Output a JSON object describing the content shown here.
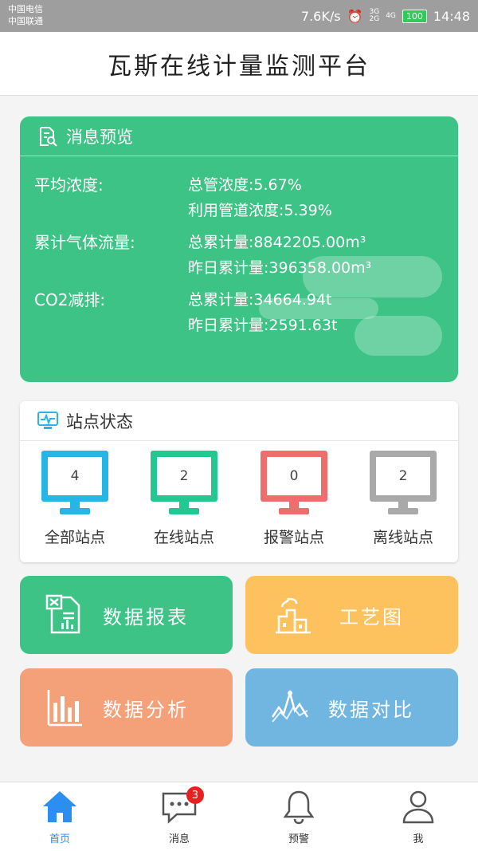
{
  "status_bar": {
    "carrier_1": "中国电信",
    "carrier_2": "中国联通",
    "speed": "7.6K/s",
    "signal_1": "3G",
    "signal_2": "2G",
    "signal_3": "4G",
    "battery": "100",
    "time": "14:48"
  },
  "header": {
    "title": "瓦斯在线计量监测平台"
  },
  "overview": {
    "title": "消息预览",
    "rows": [
      {
        "label": "平均浓度:",
        "lines": [
          "总管浓度:5.67%",
          "利用管道浓度:5.39%"
        ]
      },
      {
        "label": "累计气体流量:",
        "lines": [
          "总累计量:8842205.00m³",
          "昨日累计量:396358.00m³"
        ]
      },
      {
        "label": "CO2减排:",
        "lines": [
          "总累计量:34664.94t",
          "昨日累计量:2591.63t"
        ]
      }
    ]
  },
  "station_status": {
    "title": "站点状态",
    "items": [
      {
        "label": "全部站点",
        "count": "4",
        "color": "#27b5e6"
      },
      {
        "label": "在线站点",
        "count": "2",
        "color": "#22c88f"
      },
      {
        "label": "报警站点",
        "count": "0",
        "color": "#ec6f6d"
      },
      {
        "label": "离线站点",
        "count": "2",
        "color": "#a9a9a9"
      }
    ]
  },
  "tiles": [
    {
      "label": "数据报表",
      "icon": "report-sheet-icon",
      "color": "#3ec386"
    },
    {
      "label": "工艺图",
      "icon": "factory-icon",
      "color": "#fdc25d"
    },
    {
      "label": "数据分析",
      "icon": "bar-chart-icon",
      "color": "#f4a17a"
    },
    {
      "label": "数据对比",
      "icon": "line-compare-icon",
      "color": "#70b6e0"
    }
  ],
  "tabbar": {
    "items": [
      {
        "label": "首页",
        "icon": "home-icon",
        "active": true
      },
      {
        "label": "消息",
        "icon": "message-icon",
        "badge": "3"
      },
      {
        "label": "预警",
        "icon": "bell-icon"
      },
      {
        "label": "我",
        "icon": "user-icon"
      }
    ],
    "active_color": "#2b8ef0"
  }
}
